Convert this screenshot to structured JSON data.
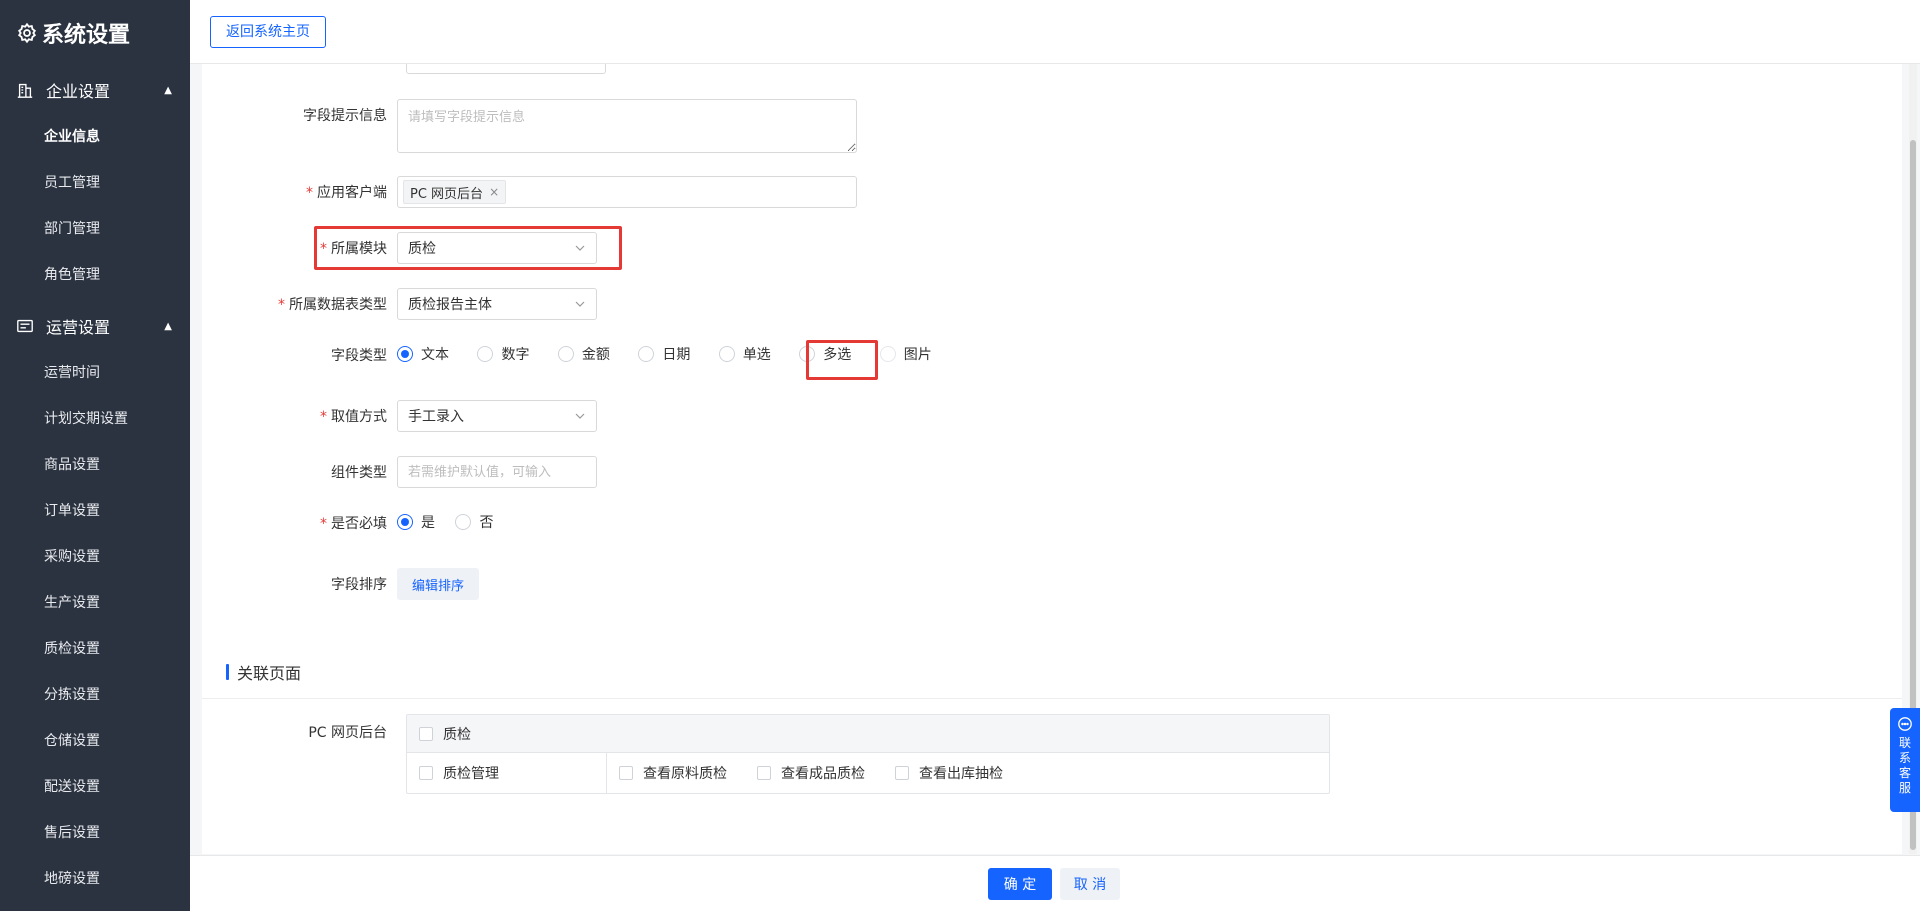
{
  "sidebar": {
    "title": "系统设置",
    "groups": [
      {
        "label": "企业设置",
        "items": [
          "企业信息",
          "员工管理",
          "部门管理",
          "角色管理"
        ]
      },
      {
        "label": "运营设置",
        "items": [
          "运营时间",
          "计划交期设置",
          "商品设置",
          "订单设置",
          "采购设置",
          "生产设置",
          "质检设置",
          "分拣设置",
          "仓储设置",
          "配送设置",
          "售后设置",
          "地磅设置"
        ]
      }
    ]
  },
  "topbar": {
    "back_label": "返回系统主页"
  },
  "form": {
    "hint": {
      "label": "字段提示信息",
      "placeholder": "请填写字段提示信息"
    },
    "client": {
      "label": "应用客户端",
      "tag": "PC 网页后台",
      "remove": "×"
    },
    "module": {
      "label": "所属模块",
      "value": "质检"
    },
    "table_type": {
      "label": "所属数据表类型",
      "value": "质检报告主体"
    },
    "field_type": {
      "label": "字段类型",
      "options": [
        "文本",
        "数字",
        "金额",
        "日期",
        "单选",
        "多选",
        "图片"
      ],
      "selected": "文本"
    },
    "value_mode": {
      "label": "取值方式",
      "value": "手工录入"
    },
    "component_type": {
      "label": "组件类型",
      "placeholder": "若需维护默认值，可输入"
    },
    "required": {
      "label": "是否必填",
      "options": [
        "是",
        "否"
      ],
      "selected": "是"
    },
    "sort": {
      "label": "字段排序",
      "button": "编辑排序"
    },
    "required_mark": "*"
  },
  "related": {
    "title": "关联页面",
    "platform": "PC 网页后台",
    "head_check": "质检",
    "row_left": "质检管理",
    "row_items": [
      "查看原料质检",
      "查看成品质检",
      "查看出库抽检"
    ]
  },
  "footer": {
    "ok": "确 定",
    "cancel": "取 消"
  },
  "support": {
    "label": "联系客服"
  },
  "colors": {
    "primary": "#1664ff",
    "sidebar": "#2b3340",
    "highlight": "#e53935"
  }
}
